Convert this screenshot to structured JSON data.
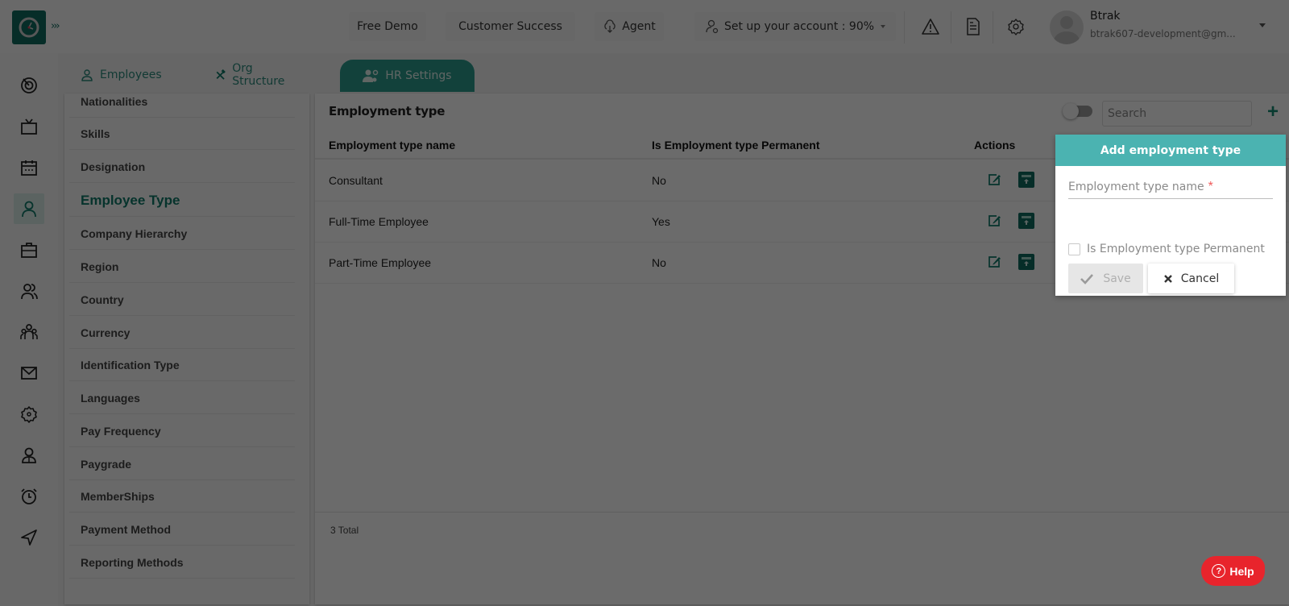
{
  "topbar": {
    "free_demo": "Free Demo",
    "customer_success": "Customer Success",
    "agent": "Agent",
    "setup_account": "Set up your account : 90%",
    "user_name": "Btrak",
    "user_email": "btrak607-development@gm..."
  },
  "tabs": [
    {
      "label": "Employees",
      "icon": "user-icon"
    },
    {
      "label": "Org Structure",
      "icon": "tools-icon"
    },
    {
      "label": "HR Settings",
      "icon": "users-cog-icon",
      "active": true
    }
  ],
  "settings_menu": [
    {
      "label": "Nationalities"
    },
    {
      "label": "Skills"
    },
    {
      "label": "Designation"
    },
    {
      "label": "Employee Type",
      "active": true
    },
    {
      "label": "Company Hierarchy"
    },
    {
      "label": "Region"
    },
    {
      "label": "Country"
    },
    {
      "label": "Currency"
    },
    {
      "label": "Identification Type"
    },
    {
      "label": "Languages"
    },
    {
      "label": "Pay Frequency"
    },
    {
      "label": "Paygrade"
    },
    {
      "label": "MemberShips"
    },
    {
      "label": "Payment Method"
    },
    {
      "label": "Reporting Methods"
    }
  ],
  "main": {
    "title": "Employment type",
    "search_placeholder": "Search",
    "add_label": "+",
    "columns": [
      "Employment type name",
      "Is Employment type Permanent",
      "Actions"
    ],
    "rows": [
      {
        "name": "Consultant",
        "permanent": "No"
      },
      {
        "name": "Full-Time Employee",
        "permanent": "Yes"
      },
      {
        "name": "Part-Time Employee",
        "permanent": "No"
      }
    ],
    "total": "3 Total"
  },
  "popup": {
    "title": "Add employment type",
    "name_label": "Employment type name",
    "required_mark": "*",
    "checkbox_label": "Is Employment type Permanent",
    "checkbox_checked": false,
    "save_label": "Save",
    "cancel_label": "Cancel"
  },
  "help": {
    "label": "Help"
  },
  "colors": {
    "brand": "#0f6b5f",
    "accent": "#4bb3b1",
    "help": "#e8242c"
  }
}
